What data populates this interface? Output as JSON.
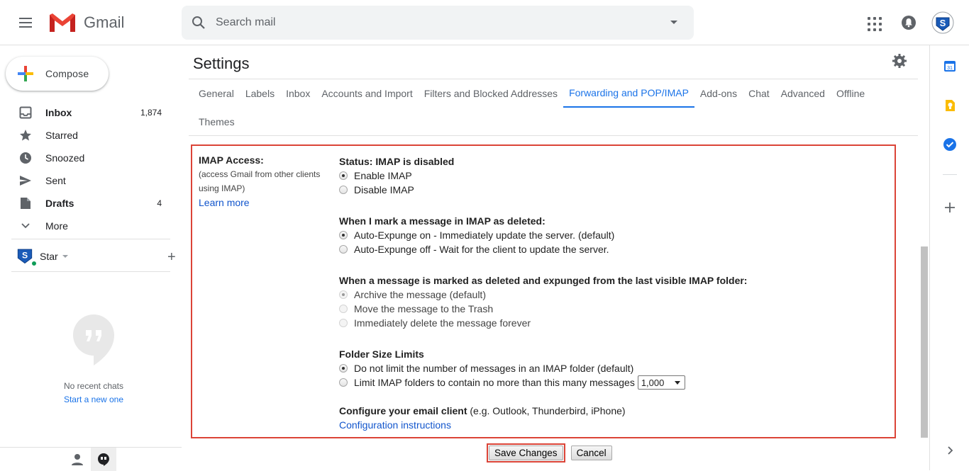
{
  "app": {
    "logo_text": "Gmail"
  },
  "search": {
    "placeholder": "Search mail"
  },
  "compose": {
    "label": "Compose"
  },
  "nav": {
    "items": [
      {
        "label": "Inbox",
        "count": "1,874",
        "icon": "inbox-icon",
        "bold": true
      },
      {
        "label": "Starred",
        "count": "",
        "icon": "star-icon",
        "bold": false
      },
      {
        "label": "Snoozed",
        "count": "",
        "icon": "clock-icon",
        "bold": false
      },
      {
        "label": "Sent",
        "count": "",
        "icon": "send-icon",
        "bold": false
      },
      {
        "label": "Drafts",
        "count": "4",
        "icon": "draft-icon",
        "bold": true
      },
      {
        "label": "More",
        "count": "",
        "icon": "chevron-down-icon",
        "bold": false
      }
    ]
  },
  "hangouts": {
    "user_name": "Star",
    "add_label": "+",
    "no_chats": "No recent chats",
    "start_new": "Start a new one"
  },
  "settings": {
    "title": "Settings",
    "tabs": [
      "General",
      "Labels",
      "Inbox",
      "Accounts and Import",
      "Filters and Blocked Addresses",
      "Forwarding and POP/IMAP",
      "Add-ons",
      "Chat",
      "Advanced",
      "Offline",
      "Themes"
    ],
    "active_tab": "Forwarding and POP/IMAP",
    "imap": {
      "label_title": "IMAP Access:",
      "label_sub1": "(access Gmail from other clients",
      "label_sub2": "using IMAP)",
      "learn_more": "Learn more",
      "status": "Status: IMAP is disabled",
      "enable": "Enable IMAP",
      "disable": "Disable IMAP",
      "deleted_head": "When I mark a message in IMAP as deleted:",
      "expunge_on": "Auto-Expunge on - Immediately update the server. (default)",
      "expunge_off": "Auto-Expunge off - Wait for the client to update the server.",
      "expunged_head": "When a message is marked as deleted and expunged from the last visible IMAP folder:",
      "archive": "Archive the message (default)",
      "trash": "Move the message to the Trash",
      "delete_forever": "Immediately delete the message forever",
      "folder_head": "Folder Size Limits",
      "no_limit": "Do not limit the number of messages in an IMAP folder (default)",
      "limit": "Limit IMAP folders to contain no more than this many messages",
      "limit_value": "1,000",
      "client_head": "Configure your email client",
      "client_examples": " (e.g. Outlook, Thunderbird, iPhone)",
      "config_link": "Configuration instructions"
    },
    "buttons": {
      "save": "Save Changes",
      "cancel": "Cancel"
    }
  },
  "colors": {
    "accent": "#1a73e8",
    "highlight_border": "#db4437",
    "link": "#1155cc"
  }
}
